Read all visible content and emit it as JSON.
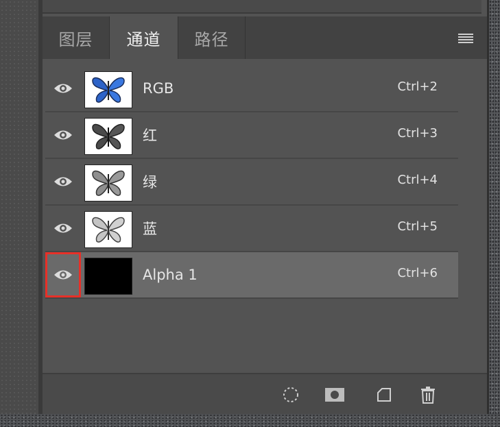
{
  "panel": {
    "tabs": [
      {
        "label": "图层",
        "active": false
      },
      {
        "label": "通道",
        "active": true
      },
      {
        "label": "路径",
        "active": false
      }
    ],
    "menu_icon": "panel-menu-icon"
  },
  "channels": [
    {
      "name": "RGB",
      "shortcut": "Ctrl+2",
      "visible": true,
      "thumb": "butterfly-color"
    },
    {
      "name": "红",
      "shortcut": "Ctrl+3",
      "visible": true,
      "thumb": "butterfly-red-gray"
    },
    {
      "name": "绿",
      "shortcut": "Ctrl+4",
      "visible": true,
      "thumb": "butterfly-green-gray"
    },
    {
      "name": "蓝",
      "shortcut": "Ctrl+5",
      "visible": true,
      "thumb": "butterfly-blue-gray"
    },
    {
      "name": "Alpha 1",
      "shortcut": "Ctrl+6",
      "visible": true,
      "selected": true,
      "thumb": "black",
      "highlight_color": "#e83028"
    }
  ],
  "toolbar": {
    "icons": [
      "load-selection-icon",
      "save-selection-mask-icon",
      "new-channel-icon",
      "delete-channel-icon"
    ]
  },
  "colors": {
    "panel_bg": "#535353",
    "selected_row": "#6a6a6a",
    "highlight": "#e83028"
  }
}
